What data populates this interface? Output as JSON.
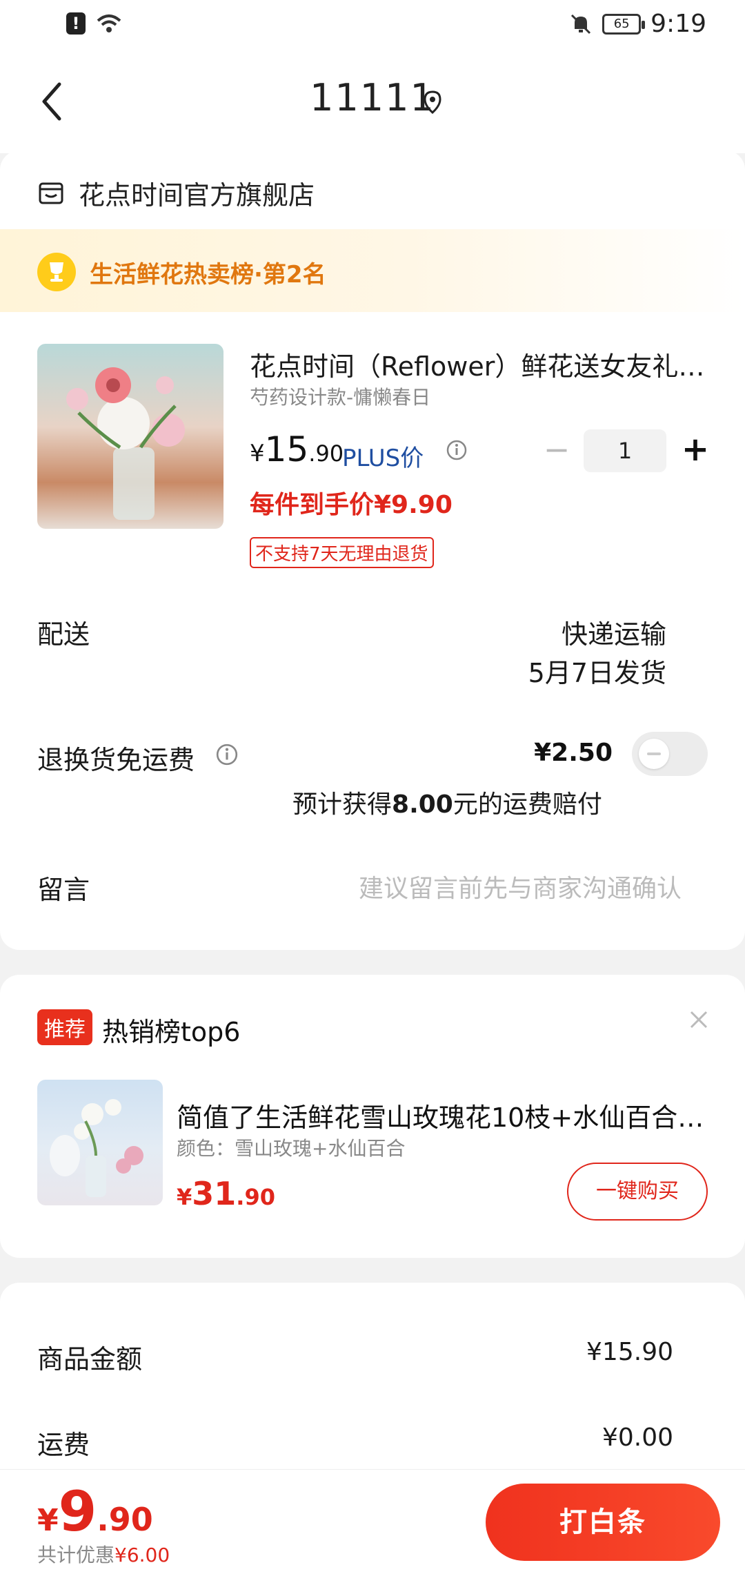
{
  "status_bar": {
    "time": "9:19",
    "battery": "65"
  },
  "nav": {
    "title": "11111"
  },
  "shop": {
    "name": "花点时间官方旗舰店"
  },
  "rank_banner": {
    "text": "生活鲜花热卖榜·第2名"
  },
  "product": {
    "title": "花点时间（Reflower）鲜花送女友礼…",
    "spec": "芍药设计款-慵懒春日",
    "price_symbol": "¥",
    "price_int": "15",
    "price_dec": ".90",
    "plus_label": "PLUS价",
    "quantity": "1",
    "final_price": "每件到手价¥9.90",
    "return_tag": "不支持7天无理由退货"
  },
  "delivery": {
    "label": "配送",
    "method": "快递运输",
    "ship_date": "5月7日发货"
  },
  "return_shipping": {
    "label": "退换货免运费",
    "price": "¥2.50",
    "note_prefix": "预计获得",
    "note_amount": "8.00",
    "note_suffix": "元的运费赔付",
    "enabled": false
  },
  "message": {
    "label": "留言",
    "placeholder": "建议留言前先与商家沟通确认"
  },
  "recommend": {
    "badge": "推荐",
    "title": "热销榜top6",
    "item_name": "简值了生活鲜花雪山玫瑰花10枝+水仙百合…",
    "item_spec": "颜色：雪山玫瑰+水仙百合",
    "price_symbol": "¥",
    "price_int": "31",
    "price_dec": ".90",
    "buy_label": "一键购买"
  },
  "summary": {
    "goods_label": "商品金额",
    "goods_value": "¥15.90",
    "shipping_label": "运费",
    "shipping_value": "¥0.00"
  },
  "bottom": {
    "price_symbol": "¥",
    "price_int": "9",
    "price_dec": ".90",
    "discount_label": "共计优惠",
    "discount_amount": "¥6.00",
    "pay_label": "打白条"
  },
  "colors": {
    "accent": "#e0261b",
    "rank": "#e0770f",
    "plus": "#1f4ea1"
  }
}
